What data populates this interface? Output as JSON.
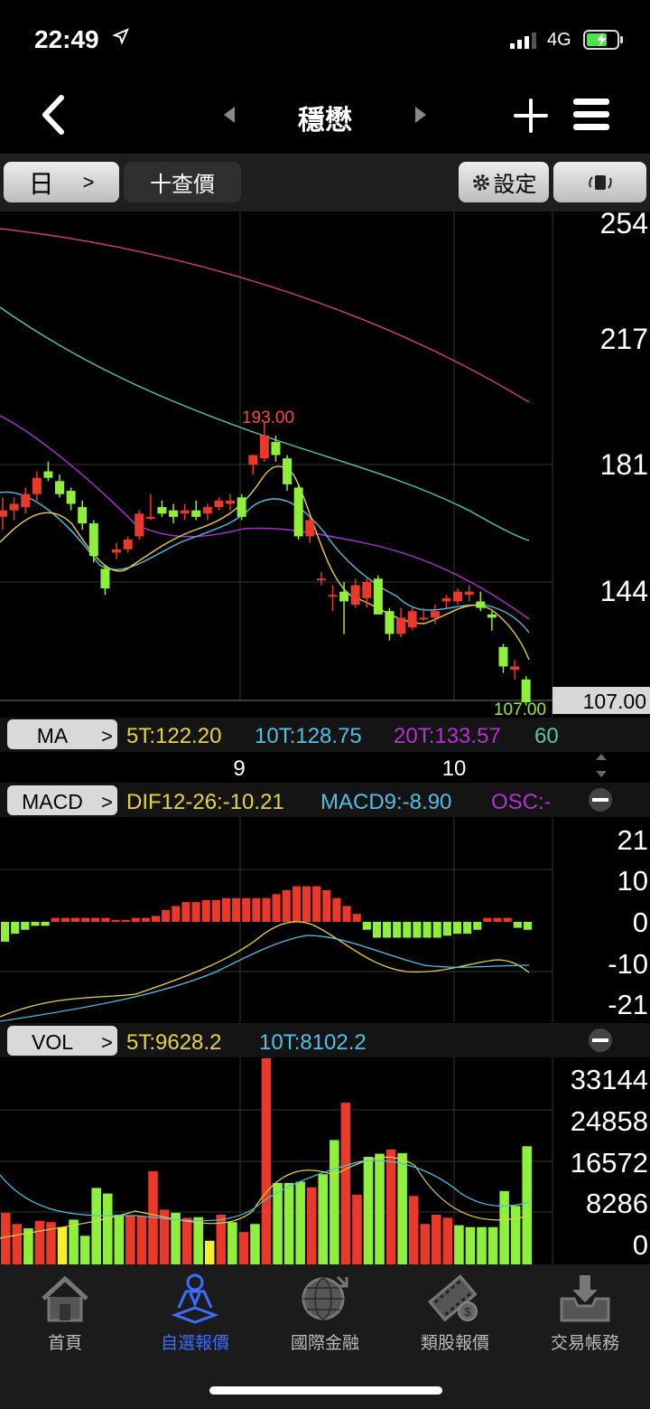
{
  "status": {
    "time": "22:49",
    "network": "4G"
  },
  "header": {
    "title": "穩懋"
  },
  "toolbar": {
    "period": "日",
    "query": "十查價",
    "settings": "設定"
  },
  "colors": {
    "up": "#e8392a",
    "down": "#8ef03a",
    "ma5": "#e8d33c",
    "ma10": "#4ec0e8",
    "ma20": "#b530d8",
    "ma60": "#53c8a8",
    "ma_long": "#d8407a"
  },
  "price_panel": {
    "y_axis": [
      "254",
      "217",
      "181",
      "144"
    ],
    "current": "107.00",
    "high_label": "193.00",
    "low_label": "107.00",
    "indicator_button": "MA",
    "legend": [
      "5T:122.20",
      "10T:128.75",
      "20T:133.57",
      "60"
    ]
  },
  "date_axis": [
    "9",
    "10"
  ],
  "macd_panel": {
    "indicator_button": "MACD",
    "legend": [
      "DIF12-26:-10.21",
      "MACD9:-8.90",
      "OSC:-"
    ],
    "y_axis": [
      "21",
      "10",
      "0",
      "-10",
      "-21"
    ]
  },
  "vol_panel": {
    "indicator_button": "VOL",
    "legend": [
      "5T:9628.2",
      "10T:8102.2"
    ],
    "y_axis": [
      "33144",
      "24858",
      "16572",
      "8286",
      "0"
    ]
  },
  "chart_data": {
    "type": "candlestick",
    "price_axis": [
      107,
      254
    ],
    "candles": [
      {
        "o": 164,
        "h": 170,
        "l": 160,
        "c": 166
      },
      {
        "o": 166,
        "h": 170,
        "l": 163,
        "c": 168
      },
      {
        "o": 167,
        "h": 173,
        "l": 165,
        "c": 171
      },
      {
        "o": 171,
        "h": 178,
        "l": 169,
        "c": 176
      },
      {
        "o": 178,
        "h": 181,
        "l": 175,
        "c": 176
      },
      {
        "o": 175,
        "h": 177,
        "l": 170,
        "c": 171
      },
      {
        "o": 172,
        "h": 173,
        "l": 166,
        "c": 168
      },
      {
        "o": 167,
        "h": 169,
        "l": 160,
        "c": 162
      },
      {
        "o": 162,
        "h": 163,
        "l": 150,
        "c": 152
      },
      {
        "o": 148,
        "h": 149,
        "l": 140,
        "c": 142
      },
      {
        "o": 153,
        "h": 156,
        "l": 151,
        "c": 154
      },
      {
        "o": 154,
        "h": 158,
        "l": 153,
        "c": 157
      },
      {
        "o": 158,
        "h": 166,
        "l": 157,
        "c": 165
      },
      {
        "o": 164,
        "h": 171,
        "l": 163,
        "c": 164
      },
      {
        "o": 167,
        "h": 169,
        "l": 164,
        "c": 165
      },
      {
        "o": 166,
        "h": 168,
        "l": 162,
        "c": 164
      },
      {
        "o": 165,
        "h": 168,
        "l": 163,
        "c": 166
      },
      {
        "o": 166,
        "h": 169,
        "l": 163,
        "c": 164
      },
      {
        "o": 165,
        "h": 168,
        "l": 163,
        "c": 167
      },
      {
        "o": 167,
        "h": 170,
        "l": 166,
        "c": 169
      },
      {
        "o": 168,
        "h": 171,
        "l": 166,
        "c": 169
      },
      {
        "o": 170,
        "h": 171,
        "l": 163,
        "c": 164
      },
      {
        "o": 180,
        "h": 182,
        "l": 177,
        "c": 183
      },
      {
        "o": 182,
        "h": 193,
        "l": 181,
        "c": 189
      },
      {
        "o": 187,
        "h": 189,
        "l": 181,
        "c": 183
      },
      {
        "o": 182,
        "h": 183,
        "l": 172,
        "c": 174
      },
      {
        "o": 173,
        "h": 174,
        "l": 157,
        "c": 158
      },
      {
        "o": 158,
        "h": 164,
        "l": 156,
        "c": 163
      },
      {
        "o": 145,
        "h": 147,
        "l": 143,
        "c": 145
      },
      {
        "o": 140,
        "h": 143,
        "l": 135,
        "c": 140
      },
      {
        "o": 141,
        "h": 144,
        "l": 128,
        "c": 138
      },
      {
        "o": 137,
        "h": 145,
        "l": 136,
        "c": 143
      },
      {
        "o": 139,
        "h": 145,
        "l": 136,
        "c": 144
      },
      {
        "o": 145,
        "h": 146,
        "l": 134,
        "c": 134
      },
      {
        "o": 135,
        "h": 136,
        "l": 126,
        "c": 128
      },
      {
        "o": 128,
        "h": 136,
        "l": 127,
        "c": 133
      },
      {
        "o": 130,
        "h": 136,
        "l": 129,
        "c": 135
      },
      {
        "o": 133,
        "h": 136,
        "l": 132,
        "c": 133
      },
      {
        "o": 133,
        "h": 137,
        "l": 131,
        "c": 135
      },
      {
        "o": 138,
        "h": 140,
        "l": 136,
        "c": 139
      },
      {
        "o": 138,
        "h": 142,
        "l": 137,
        "c": 141
      },
      {
        "o": 140,
        "h": 143,
        "l": 138,
        "c": 141
      },
      {
        "o": 138,
        "h": 141,
        "l": 135,
        "c": 136
      },
      {
        "o": 134,
        "h": 135,
        "l": 129,
        "c": 133
      },
      {
        "o": 124,
        "h": 125,
        "l": 116,
        "c": 118
      },
      {
        "o": 117,
        "h": 120,
        "l": 114,
        "c": 118
      },
      {
        "o": 114,
        "h": 115,
        "l": 106,
        "c": 107
      }
    ],
    "macd_bars": [
      -5,
      -3,
      -2,
      -1,
      -1,
      1,
      1,
      1,
      1,
      1,
      1,
      0.5,
      0.5,
      1,
      1,
      1.5,
      3,
      4,
      5,
      5,
      5.5,
      5.5,
      6,
      6,
      6,
      6,
      6,
      7,
      8,
      9,
      9,
      9,
      8,
      6,
      4,
      2,
      -2,
      -4,
      -4,
      -4,
      -4,
      -4,
      -4,
      -4,
      -3.5,
      -3,
      -3,
      -2,
      1,
      1,
      1,
      -1.5,
      -2
    ],
    "volume": [
      {
        "v": 8286,
        "c": "up"
      },
      {
        "v": 6500,
        "c": "up"
      },
      {
        "v": 5800,
        "c": "down"
      },
      {
        "v": 7000,
        "c": "up"
      },
      {
        "v": 6800,
        "c": "up"
      },
      {
        "v": 6000,
        "c": "yellow"
      },
      {
        "v": 7200,
        "c": "down"
      },
      {
        "v": 4600,
        "c": "down"
      },
      {
        "v": 12300,
        "c": "down"
      },
      {
        "v": 11400,
        "c": "down"
      },
      {
        "v": 8000,
        "c": "down"
      },
      {
        "v": 7800,
        "c": "up"
      },
      {
        "v": 7800,
        "c": "up"
      },
      {
        "v": 15000,
        "c": "up"
      },
      {
        "v": 8800,
        "c": "up"
      },
      {
        "v": 8300,
        "c": "down"
      },
      {
        "v": 7500,
        "c": "up"
      },
      {
        "v": 7600,
        "c": "down"
      },
      {
        "v": 3800,
        "c": "yellow"
      },
      {
        "v": 8000,
        "c": "up"
      },
      {
        "v": 6800,
        "c": "down"
      },
      {
        "v": 5200,
        "c": "up"
      },
      {
        "v": 6500,
        "c": "down"
      },
      {
        "v": 33144,
        "c": "up"
      },
      {
        "v": 13100,
        "c": "down"
      },
      {
        "v": 13100,
        "c": "down"
      },
      {
        "v": 13300,
        "c": "down"
      },
      {
        "v": 12400,
        "c": "up"
      },
      {
        "v": 14500,
        "c": "down"
      },
      {
        "v": 20000,
        "c": "down"
      },
      {
        "v": 26000,
        "c": "up"
      },
      {
        "v": 11200,
        "c": "up"
      },
      {
        "v": 17300,
        "c": "down"
      },
      {
        "v": 17800,
        "c": "down"
      },
      {
        "v": 18500,
        "c": "up"
      },
      {
        "v": 17900,
        "c": "down"
      },
      {
        "v": 11000,
        "c": "up"
      },
      {
        "v": 6500,
        "c": "up"
      },
      {
        "v": 8000,
        "c": "up"
      },
      {
        "v": 7500,
        "c": "up"
      },
      {
        "v": 6300,
        "c": "down"
      },
      {
        "v": 6000,
        "c": "down"
      },
      {
        "v": 6000,
        "c": "down"
      },
      {
        "v": 6000,
        "c": "down"
      },
      {
        "v": 11800,
        "c": "down"
      },
      {
        "v": 9400,
        "c": "down"
      },
      {
        "v": 19000,
        "c": "down"
      }
    ]
  },
  "tabs": [
    {
      "label": "首頁"
    },
    {
      "label": "自選報價"
    },
    {
      "label": "國際金融"
    },
    {
      "label": "類股報價"
    },
    {
      "label": "交易帳務"
    }
  ]
}
